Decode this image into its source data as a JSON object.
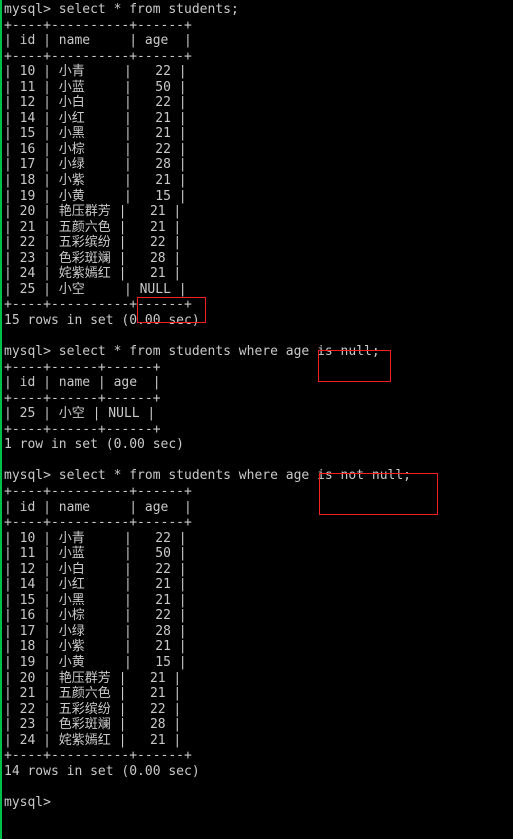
{
  "terminal": {
    "prompt": "mysql>",
    "text_color": "#c9c9c9",
    "background_color": "#000000",
    "accent_color": "#00c04a",
    "highlight_color": "#f4201c"
  },
  "columns": {
    "id": "id",
    "name": "name",
    "age": "age"
  },
  "blocks": [
    {
      "id": "block-select-all",
      "command": "mysql> select * from students;",
      "rule_wide": "+----+----------+------+",
      "header": "| id | name     | age  |",
      "rows": [
        "|  10 | 小青       |   22 |",
        "|  11 | 小蓝       |   50 |"
      ],
      "footer": "15 rows in set (0.00 sec)"
    }
  ],
  "queries": {
    "select_all": "mysql> select * from students;",
    "where_is_null_prefix": "mysql> select * from students where age ",
    "where_is_null_highlight": "is null;",
    "where_is_not_null_prefix": "mysql> select * from students where age ",
    "where_is_not_null_highlight": "is not null;"
  },
  "results": {
    "full_table": {
      "columns": [
        "id",
        "name",
        "age"
      ],
      "rows": [
        {
          "id": "10",
          "name": "小青",
          "age": "22"
        },
        {
          "id": "11",
          "name": "小蓝",
          "age": "50"
        },
        {
          "id": "12",
          "name": "小白",
          "age": "22"
        },
        {
          "id": "14",
          "name": "小红",
          "age": "21"
        },
        {
          "id": "15",
          "name": "小黑",
          "age": "21"
        },
        {
          "id": "16",
          "name": "小棕",
          "age": "22"
        },
        {
          "id": "17",
          "name": "小绿",
          "age": "28"
        },
        {
          "id": "18",
          "name": "小紫",
          "age": "21"
        },
        {
          "id": "19",
          "name": "小黄",
          "age": "15"
        },
        {
          "id": "20",
          "name": "艳压群芳",
          "age": "21"
        },
        {
          "id": "21",
          "name": "五颜六色",
          "age": "21"
        },
        {
          "id": "22",
          "name": "五彩缤纷",
          "age": "22"
        },
        {
          "id": "23",
          "name": "色彩斑斓",
          "age": "28"
        },
        {
          "id": "24",
          "name": "姹紫嫣红",
          "age": "21"
        },
        {
          "id": "25",
          "name": "小空",
          "age": "NULL"
        }
      ],
      "status": "15 rows in set (0.00 sec)"
    },
    "is_null_table": {
      "columns": [
        "id",
        "name",
        "age"
      ],
      "rows": [
        {
          "id": "25",
          "name": "小空",
          "age": "NULL"
        }
      ],
      "status": "1 row in set (0.00 sec)"
    },
    "is_not_null_table": {
      "columns": [
        "id",
        "name",
        "age"
      ],
      "rows": [
        {
          "id": "10",
          "name": "小青",
          "age": "22"
        },
        {
          "id": "11",
          "name": "小蓝",
          "age": "50"
        },
        {
          "id": "12",
          "name": "小白",
          "age": "22"
        },
        {
          "id": "14",
          "name": "小红",
          "age": "21"
        },
        {
          "id": "15",
          "name": "小黑",
          "age": "21"
        },
        {
          "id": "16",
          "name": "小棕",
          "age": "22"
        },
        {
          "id": "17",
          "name": "小绿",
          "age": "28"
        },
        {
          "id": "18",
          "name": "小紫",
          "age": "21"
        },
        {
          "id": "19",
          "name": "小黄",
          "age": "15"
        },
        {
          "id": "20",
          "name": "艳压群芳",
          "age": "21"
        },
        {
          "id": "21",
          "name": "五颜六色",
          "age": "21"
        },
        {
          "id": "22",
          "name": "五彩缤纷",
          "age": "22"
        },
        {
          "id": "23",
          "name": "色彩斑斓",
          "age": "28"
        },
        {
          "id": "24",
          "name": "姹紫嫣红",
          "age": "21"
        }
      ],
      "status": "14 rows in set (0.00 sec)"
    }
  },
  "final_prompt": "mysql>",
  "annotations": [
    {
      "name": "null-cell-highlight",
      "target": "NULL"
    },
    {
      "name": "is-null-clause-highlight",
      "target": "is null;"
    },
    {
      "name": "is-not-null-clause-highlight",
      "target": "is not null;"
    }
  ]
}
